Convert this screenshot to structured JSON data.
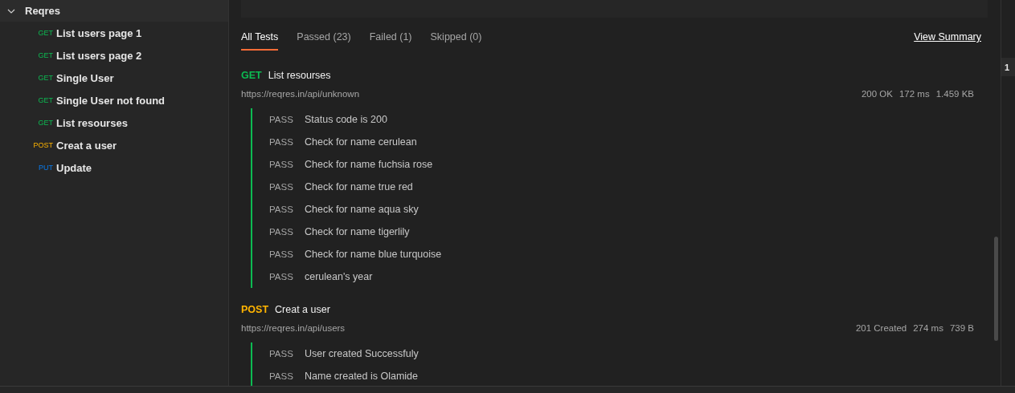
{
  "sidebar": {
    "collection": {
      "name": "Reqres",
      "expanded": true
    },
    "items": [
      {
        "method": "GET",
        "name": "List users page 1"
      },
      {
        "method": "GET",
        "name": "List users page 2"
      },
      {
        "method": "GET",
        "name": "Single User"
      },
      {
        "method": "GET",
        "name": "Single User not found"
      },
      {
        "method": "GET",
        "name": "List resourses"
      },
      {
        "method": "POST",
        "name": "Creat a user"
      },
      {
        "method": "PUT",
        "name": "Update"
      }
    ]
  },
  "tabs": [
    {
      "label": "All Tests",
      "selected": true
    },
    {
      "label": "Passed (23)",
      "selected": false
    },
    {
      "label": "Failed (1)",
      "selected": false
    },
    {
      "label": "Skipped (0)",
      "selected": false
    }
  ],
  "summary_link": "View Summary",
  "gutter_tab": "1",
  "requests": [
    {
      "method": "GET",
      "name": "List resourses",
      "url": "https://reqres.in/api/unknown",
      "status": "200 OK",
      "time": "172 ms",
      "size": "1.459 KB",
      "tests": [
        {
          "result": "PASS",
          "passed": true,
          "name": "Status code is 200"
        },
        {
          "result": "PASS",
          "passed": true,
          "name": "Check for name cerulean"
        },
        {
          "result": "PASS",
          "passed": true,
          "name": "Check for name fuchsia rose"
        },
        {
          "result": "PASS",
          "passed": true,
          "name": "Check for name true red"
        },
        {
          "result": "PASS",
          "passed": true,
          "name": "Check for name aqua sky"
        },
        {
          "result": "PASS",
          "passed": true,
          "name": "Check for name tigerlily"
        },
        {
          "result": "PASS",
          "passed": true,
          "name": "Check for name blue turquoise"
        },
        {
          "result": "PASS",
          "passed": true,
          "name": "cerulean's year"
        }
      ]
    },
    {
      "method": "POST",
      "name": "Creat a user",
      "url": "https://reqres.in/api/users",
      "status": "201 Created",
      "time": "274 ms",
      "size": "739 B",
      "tests": [
        {
          "result": "PASS",
          "passed": true,
          "name": "User created Successfuly"
        },
        {
          "result": "PASS",
          "passed": true,
          "name": "Name created is Olamide"
        }
      ]
    }
  ]
}
